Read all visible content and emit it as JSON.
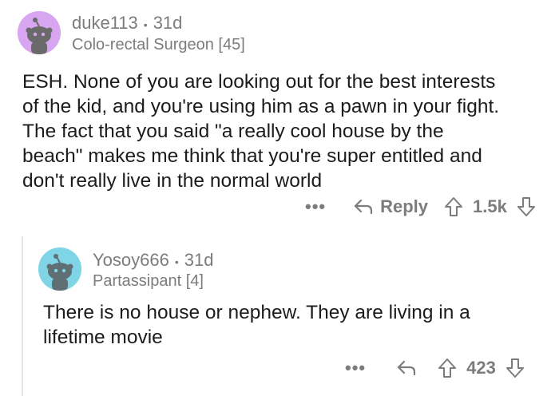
{
  "comments": [
    {
      "username": "duke113",
      "separator": "•",
      "time": "31d",
      "flair": "Colo-rectal Surgeon [45]",
      "body_lines": [
        "ESH. None of you are looking out for the best interests",
        "of the kid, and you're using him as a pawn in your fight.",
        "The fact that you said \"a really cool house by the",
        "beach\" makes me think that you're super entitled and",
        "don't really live in the normal world"
      ],
      "more": "•••",
      "reply_label": "Reply",
      "score": "1.5k",
      "avatar_color": "#d8a6f0"
    },
    {
      "username": "Yosoy666",
      "separator": "•",
      "time": "31d",
      "flair": "Partassipant [4]",
      "body_lines": [
        "There is no house or nephew. They are living in a",
        "lifetime movie"
      ],
      "more": "•••",
      "score": "423",
      "avatar_color": "#7fd4e6"
    }
  ],
  "colors": {
    "meta": "#7c7c7c",
    "text": "#1c1c1c",
    "thread": "#e6e6e6"
  },
  "icons": [
    "reddit-avatar-icon",
    "reply-arrow-icon",
    "upvote-icon",
    "downvote-icon",
    "more-icon"
  ]
}
